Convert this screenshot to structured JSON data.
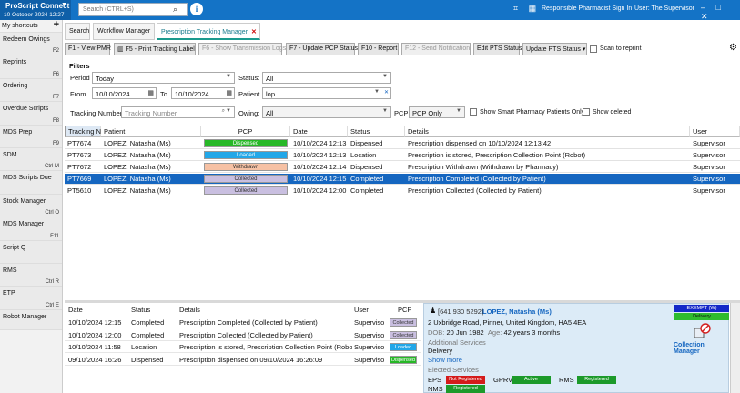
{
  "app": {
    "brand": "ProScript Connect",
    "datetime": "10 October 2024 12:27",
    "search_placeholder": "Search (CTRL+S)",
    "responsible_pharmacist": "Responsible Pharmacist Sign In",
    "user_label": "User: The Supervisor"
  },
  "sidebar": {
    "header": "My shortcuts",
    "items": [
      {
        "label": "Redeem Owings",
        "key": "F2"
      },
      {
        "label": "Reprints",
        "key": "F6"
      },
      {
        "label": "Ordering",
        "key": "F7"
      },
      {
        "label": "Overdue Scripts",
        "key": "F8"
      },
      {
        "label": "MDS Prep",
        "key": "F9"
      },
      {
        "label": "SDM",
        "key": "Ctrl M"
      },
      {
        "label": "MDS Scripts Due",
        "key": ""
      },
      {
        "label": "Stock Manager",
        "key": "Ctrl O"
      },
      {
        "label": "MDS Manager",
        "key": "F11"
      },
      {
        "label": "Script Q",
        "key": ""
      },
      {
        "label": "RMS",
        "key": "Ctrl R"
      },
      {
        "label": "ETP",
        "key": "Ctrl E"
      },
      {
        "label": "Robot Manager",
        "key": ""
      }
    ]
  },
  "tabs": [
    "Search",
    "Workflow Manager",
    "Prescription Tracking Manager"
  ],
  "toolbar": {
    "view_pmr": "F1 - View PMR",
    "print_label": "F5 - Print Tracking Label",
    "show_logs": "F6 - Show Transmission Logs",
    "update_pcp": "F7 - Update PCP Status",
    "report": "F10 - Report",
    "send_notification": "F12 - Send Notification",
    "edit_pts": "Edit PTS Status",
    "update_pts": "Update PTS Status",
    "scan_reprint": "Scan to reprint"
  },
  "filters": {
    "title": "Filters",
    "period_label": "Period",
    "period_value": "Today",
    "status_label": "Status:",
    "status_value": "All",
    "from_label": "From",
    "from_value": "10/10/2024",
    "to_label": "To",
    "to_value": "10/10/2024",
    "patient_label": "Patient",
    "patient_value": "lop",
    "tracking_label": "Tracking Number",
    "tracking_placeholder": "Tracking Number",
    "owing_label": "Owing:",
    "owing_value": "All",
    "pcp_label": "PCP",
    "pcp_value": "PCP Only",
    "smart_label": "Show Smart Pharmacy Patients Only",
    "deleted_label": "Show deleted"
  },
  "grid": {
    "columns": [
      "Tracking N",
      "Patient",
      "PCP",
      "Date",
      "Status",
      "Details",
      "User"
    ],
    "rows": [
      {
        "tracking": "PT7674",
        "patient": "LOPEZ, Natasha (Ms)",
        "pcp": "Dispensed",
        "pcp_color": "#27b827",
        "pcp_text": "#fff",
        "date": "10/10/2024 12:13",
        "status": "Dispensed",
        "details": "Prescription dispensed on 10/10/2024 12:13:42",
        "user": "Supervisor"
      },
      {
        "tracking": "PT7673",
        "patient": "LOPEZ, Natasha (Ms)",
        "pcp": "Loaded",
        "pcp_color": "#22a7e8",
        "pcp_text": "#fff",
        "date": "10/10/2024 12:13",
        "status": "Location",
        "details": "Prescription is stored, Prescription Collection Point (Robot)",
        "user": "Supervisor"
      },
      {
        "tracking": "PT7672",
        "patient": "LOPEZ, Natasha (Ms)",
        "pcp": "Withdrawn",
        "pcp_color": "#f6c1a4",
        "pcp_text": "#333",
        "date": "10/10/2024 12:14",
        "status": "Dispensed",
        "details": "Prescription Withdrawn (Withdrawn by Pharmacy)",
        "user": "Supervisor"
      },
      {
        "tracking": "PT7669",
        "patient": "LOPEZ, Natasha (Ms)",
        "pcp": "Collected",
        "pcp_color": "#c9bfe0",
        "pcp_text": "#333",
        "date": "10/10/2024 12:15",
        "status": "Completed",
        "details": "Prescription Completed (Collected by Patient)",
        "user": "Supervisor"
      },
      {
        "tracking": "PT5610",
        "patient": "LOPEZ, Natasha (Ms)",
        "pcp": "Collected",
        "pcp_color": "#c9bfe0",
        "pcp_text": "#333",
        "date": "10/10/2024 12:00",
        "status": "Completed",
        "details": "Prescription Collected (Collected by Patient)",
        "user": "Supervisor"
      }
    ]
  },
  "history": {
    "columns": [
      "Date",
      "Status",
      "Details",
      "User",
      "PCP"
    ],
    "rows": [
      {
        "date": "10/10/2024 12:15",
        "status": "Completed",
        "details": "Prescription Completed (Collected by Patient)",
        "user": "Superviso",
        "pcp": "Collected",
        "pcp_color": "#c9bfe0",
        "pcp_text": "#333"
      },
      {
        "date": "10/10/2024 12:00",
        "status": "Completed",
        "details": "Prescription Collected (Collected by Patient)",
        "user": "Superviso",
        "pcp": "Collected",
        "pcp_color": "#c9bfe0",
        "pcp_text": "#333"
      },
      {
        "date": "10/10/2024 11:58",
        "status": "Location",
        "details": "Prescription is stored, Prescription Collection Point (Robot)",
        "user": "Superviso",
        "pcp": "Loaded",
        "pcp_color": "#22a7e8",
        "pcp_text": "#fff"
      },
      {
        "date": "09/10/2024 16:26",
        "status": "Dispensed",
        "details": "Prescription dispensed on 09/10/2024 16:26:09",
        "user": "Superviso",
        "pcp": "Dispensed",
        "pcp_color": "#27b827",
        "pcp_text": "#fff"
      }
    ]
  },
  "patient_panel": {
    "nhs": "[641 930 5292]",
    "name": "LOPEZ, Natasha (Ms)",
    "address": "2 Uxbridge Road, Pinner, United Kingdom, HA5 4EA",
    "dob_label": "DOB:",
    "dob": "20 Jun 1982",
    "age_label": "Age:",
    "age": "42 years 3 months",
    "additional_services": "Additional Services",
    "delivery": "Delivery",
    "show_more": "Show more",
    "elected_services": "Elected Services",
    "eps_label": "EPS",
    "eps_value": "Not Registered",
    "gprv_label": "GPRV",
    "gprv_value": "Active",
    "rms_label": "RMS",
    "rms_value": "Registered",
    "nms_label": "NMS",
    "nms_value": "Registered",
    "exempt": "EXEMPT (W)",
    "delivery_badge": "Delivery",
    "collection_manager": "Collection Manager"
  }
}
